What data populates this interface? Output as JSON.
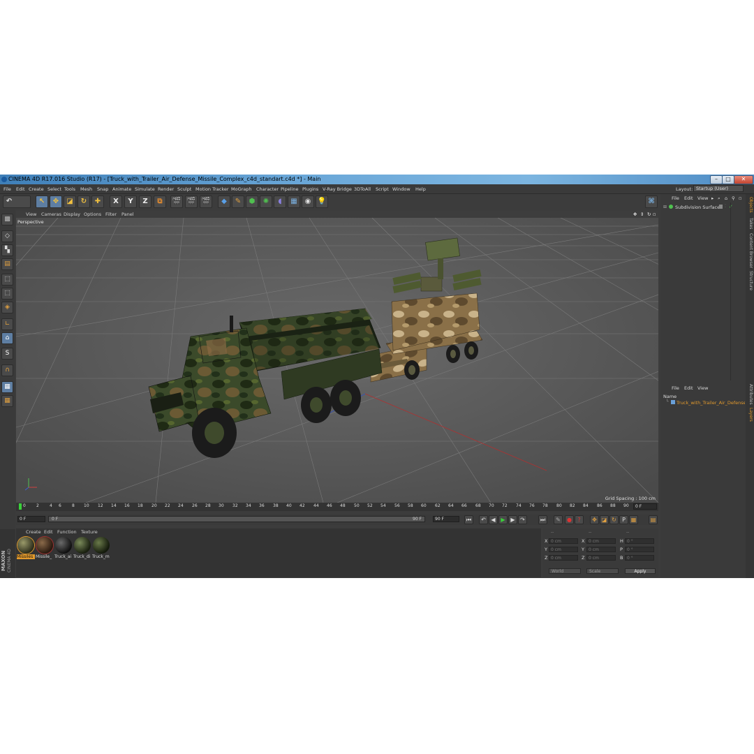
{
  "window": {
    "title": "CINEMA 4D R17.016 Studio (R17) - [Truck_with_Trailer_Air_Defense_Missile_Complex_c4d_standart.c4d *] - Main",
    "minimize": "–",
    "maximize": "□",
    "close": "✕"
  },
  "menu": [
    "File",
    "Edit",
    "Create",
    "Select",
    "Tools",
    "Mesh",
    "Snap",
    "Animate",
    "Simulate",
    "Render",
    "Sculpt",
    "Motion Tracker",
    "MoGraph",
    "Character",
    "Pipeline",
    "Plugins",
    "V-Ray Bridge",
    "3DToAll",
    "Script",
    "Window",
    "Help"
  ],
  "layout": {
    "label": "Layout:",
    "value": "Startup (User)"
  },
  "toolbar": {
    "x_label": "X",
    "y_label": "Y",
    "z_label": "Z"
  },
  "lefttools": {
    "snap_label": "S"
  },
  "viewport": {
    "menu": [
      "View",
      "Cameras",
      "Display",
      "Options",
      "Filter",
      "Panel"
    ],
    "label": "Perspective",
    "grid_spacing": "Grid Spacing : 100 cm"
  },
  "timeline": {
    "ticks": [
      "0",
      "2",
      "4",
      "6",
      "8",
      "10",
      "12",
      "14",
      "16",
      "18",
      "20",
      "22",
      "24",
      "26",
      "28",
      "30",
      "32",
      "34",
      "36",
      "38",
      "40",
      "42",
      "44",
      "46",
      "48",
      "50",
      "52",
      "54",
      "56",
      "58",
      "60",
      "62",
      "64",
      "66",
      "68",
      "70",
      "72",
      "74",
      "76",
      "78",
      "80",
      "82",
      "84",
      "86",
      "88",
      "90"
    ],
    "current_frame": "0 F"
  },
  "transport": {
    "start_field": "0 F",
    "range_start": "0 F",
    "range_end": "90 F",
    "end_field": "90 F"
  },
  "materials": {
    "menu": [
      "Create",
      "Edit",
      "Function",
      "Texture"
    ],
    "items": [
      {
        "label": "Missiles"
      },
      {
        "label": "Missile_"
      },
      {
        "label": "Truck_ai"
      },
      {
        "label": "Truck_di"
      },
      {
        "label": "Truck_m"
      }
    ]
  },
  "coords": {
    "header": [
      "--",
      "--",
      "--"
    ],
    "rows": [
      {
        "a": "X",
        "av": "0 cm",
        "b": "X",
        "bv": "0 cm",
        "c": "H",
        "cv": "0 °"
      },
      {
        "a": "Y",
        "av": "0 cm",
        "b": "Y",
        "bv": "0 cm",
        "c": "P",
        "cv": "0 °"
      },
      {
        "a": "Z",
        "av": "0 cm",
        "b": "Z",
        "bv": "0 cm",
        "c": "B",
        "cv": "0 °"
      }
    ],
    "world": "World",
    "scale": "Scale",
    "apply": "Apply"
  },
  "objects": {
    "menu": [
      "File",
      "Edit",
      "View"
    ],
    "item": "Subdivision Surface"
  },
  "layers": {
    "menu": [
      "File",
      "Edit",
      "View"
    ],
    "column": "Name",
    "item": "Truck_with_Trailer_Air_Defense_M"
  },
  "sidetabs": [
    "Objects",
    "Takes",
    "Content Browser",
    "Structure",
    "Attributes",
    "Layers"
  ],
  "brand": {
    "maxon": "MAXON",
    "product": "CINEMA 4D"
  }
}
